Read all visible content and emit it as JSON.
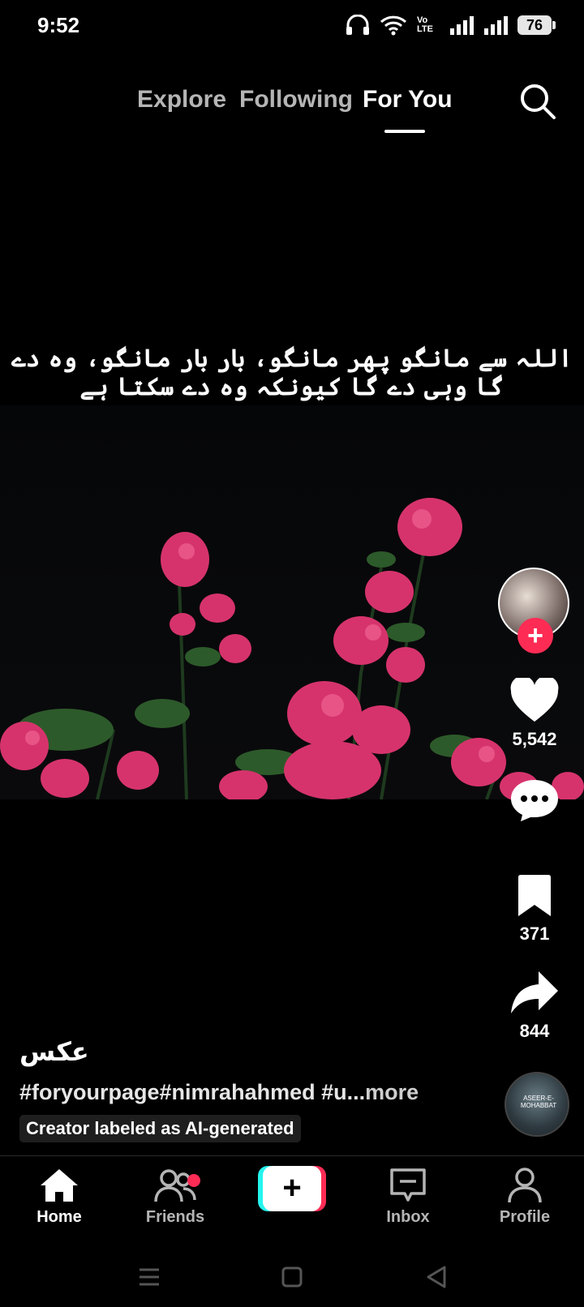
{
  "status_bar": {
    "time": "9:52",
    "battery": "76",
    "network": "Vo LTE"
  },
  "top_nav": {
    "tabs": [
      {
        "label": "Explore"
      },
      {
        "label": "Following"
      },
      {
        "label": "For You"
      }
    ],
    "active_tab": "For You",
    "search_icon": "search-icon"
  },
  "video": {
    "overlay_text": "اللہ سے مانگو پھر مانگو، بار بار مانگو، وہ دے گا وہی دے گا کیونکہ وہ دے سکتا ہے"
  },
  "actions": {
    "likes": "5,542",
    "bookmarks": "371",
    "shares": "844",
    "follow_symbol": "+"
  },
  "sound_disc": {
    "label": "ASEER-E-MOHABBAT"
  },
  "post": {
    "author": "عکس",
    "hashtags": "#foryourpage#nimrahahmed  #u...",
    "more": "more",
    "ai_label": "Creator labeled as AI-generated"
  },
  "bottom_nav": {
    "items": [
      {
        "label": "Home"
      },
      {
        "label": "Friends"
      },
      {
        "label": "+"
      },
      {
        "label": "Inbox"
      },
      {
        "label": "Profile"
      }
    ],
    "active": "Home",
    "accent_red": "#fe2c55",
    "accent_cyan": "#25f4ee"
  }
}
